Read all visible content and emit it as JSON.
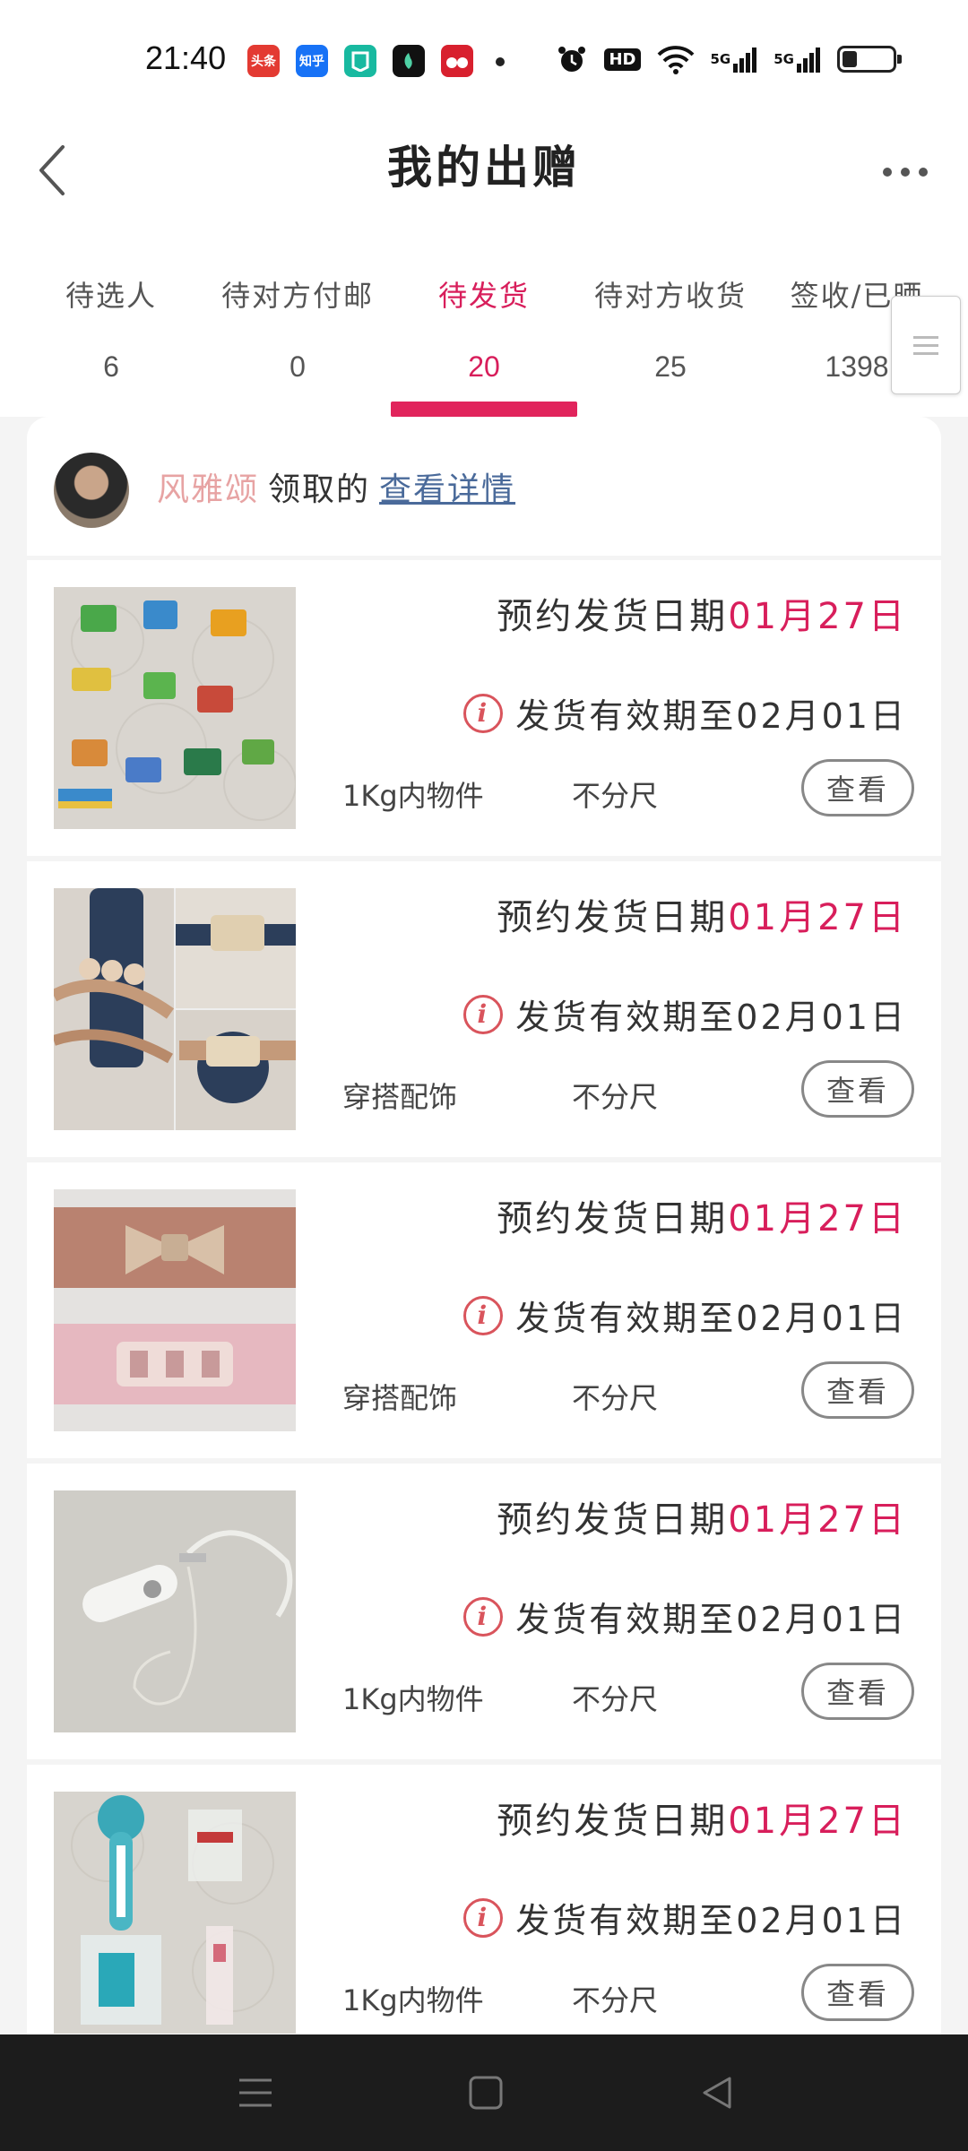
{
  "status_bar": {
    "time": "21:40",
    "notifications": [
      {
        "name": "toutiao-icon",
        "label": "头条",
        "color": "#e33a32"
      },
      {
        "name": "zhihu-icon",
        "label": "知乎",
        "color": "#1772f6"
      },
      {
        "name": "app-green-icon",
        "label": "",
        "color": "#18b9a0"
      },
      {
        "name": "app-black-icon",
        "label": "",
        "color": "#111111"
      },
      {
        "name": "app-red-icon",
        "label": "",
        "color": "#d8202e"
      }
    ],
    "network": [
      "5G",
      "5G"
    ],
    "hd_label": "HD",
    "battery_level": 0.3
  },
  "header": {
    "title": "我的出赠"
  },
  "tabs": [
    {
      "label": "待选人",
      "count": "6"
    },
    {
      "label": "待对方付邮",
      "count": "0"
    },
    {
      "label": "待发货",
      "count": "20",
      "active": true
    },
    {
      "label": "待对方收货",
      "count": "25"
    },
    {
      "label": "签收/已晒",
      "count": "1398"
    }
  ],
  "giver": {
    "name": "风雅颂",
    "claim_text": "领取的",
    "detail_link": "查看详情"
  },
  "items": [
    {
      "ship_label": "预约发货日期",
      "ship_date": "01月27日",
      "deadline": "发货有效期至02月01日",
      "category": "1Kg内物件",
      "size": "不分尺",
      "button": "查看"
    },
    {
      "ship_label": "预约发货日期",
      "ship_date": "01月27日",
      "deadline": "发货有效期至02月01日",
      "category": "穿搭配饰",
      "size": "不分尺",
      "button": "查看"
    },
    {
      "ship_label": "预约发货日期",
      "ship_date": "01月27日",
      "deadline": "发货有效期至02月01日",
      "category": "穿搭配饰",
      "size": "不分尺",
      "button": "查看"
    },
    {
      "ship_label": "预约发货日期",
      "ship_date": "01月27日",
      "deadline": "发货有效期至02月01日",
      "category": "1Kg内物件",
      "size": "不分尺",
      "button": "查看"
    },
    {
      "ship_label": "预约发货日期",
      "ship_date": "01月27日",
      "deadline": "发货有效期至02月01日",
      "category": "1Kg内物件",
      "size": "不分尺",
      "button": "查看"
    }
  ],
  "colors": {
    "accent": "#d81e5b",
    "giver_name": "#e7a3a3",
    "link": "#4a6a9a",
    "info_icon": "#d9545c"
  }
}
